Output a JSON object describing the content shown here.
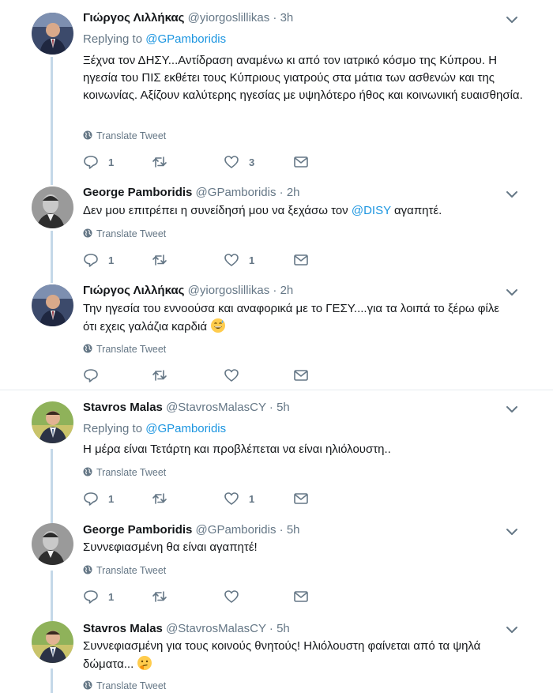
{
  "tweets": [
    {
      "name": "Γιώργος Λιλλήκας",
      "handle": "@yiorgoslillikas",
      "dot": "·",
      "time": "3h",
      "replying_prefix": "Replying to ",
      "replying_to": "@GPamboridis",
      "text": "Ξέχνα τον ΔΗΣΥ...Αντίδραση αναμένω κι από τον ιατρικό κόσμο της Κύπρου. Η ηγεσία του ΠΙΣ εκθέτει τους Κύπριους γιατρούς στα μάτια των ασθενών και της κοινωνίας. Αξίζουν καλύτερης ηγεσίας με υψηλότερο ήθος και κοινωνική ευαισθησία.",
      "translate": "Translate Tweet",
      "replies": "1",
      "retweets": "",
      "likes": "3"
    },
    {
      "name": "George Pamboridis",
      "handle": "@GPamboridis",
      "dot": "·",
      "time": "2h",
      "text_before": "Δεν μου επιτρέπει η συνείδησή μου να ξεχάσω τον ",
      "text_mention": "@DISY",
      "text_after": " αγαπητέ.",
      "translate": "Translate Tweet",
      "replies": "1",
      "retweets": "",
      "likes": "1"
    },
    {
      "name": "Γιώργος Λιλλήκας",
      "handle": "@yiorgoslillikas",
      "dot": "·",
      "time": "2h",
      "text": "Την ηγεσία του εννοούσα και αναφορικά με το ΓΕΣΥ....για τα λοιπά το ξέρω φίλε ότι εχεις γαλάζια καρδιά ",
      "emoji": "grinning-sweat-emoji",
      "translate": "Translate Tweet",
      "replies": "",
      "retweets": "",
      "likes": ""
    },
    {
      "name": "Stavros Malas",
      "handle": "@StavrosMalasCY",
      "dot": "·",
      "time": "5h",
      "replying_prefix": "Replying to ",
      "replying_to": "@GPamboridis",
      "text": "Η μέρα είναι Τετάρτη και προβλέπεται να είναι  ηλιόλουστη..",
      "translate": "Translate Tweet",
      "replies": "1",
      "retweets": "",
      "likes": "1"
    },
    {
      "name": "George Pamboridis",
      "handle": "@GPamboridis",
      "dot": "·",
      "time": "5h",
      "text": "Συννεφιασμένη θα είναι αγαπητέ!",
      "translate": "Translate Tweet",
      "replies": "1",
      "retweets": "",
      "likes": ""
    },
    {
      "name": "Stavros Malas",
      "handle": "@StavrosMalasCY",
      "dot": "·",
      "time": "5h",
      "text": "Συννεφιασμένη για τους κοινούς θνητούς! Ηλιόλουστη φαίνεται από τα ψηλά δώματα... ",
      "emoji": "thinking-face-emoji",
      "translate": "Translate Tweet"
    }
  ],
  "colors": {
    "link": "#1b95e0",
    "secondary_text": "#657786",
    "thread_line": "#c4d8e8",
    "divider": "#e6ecf0"
  }
}
